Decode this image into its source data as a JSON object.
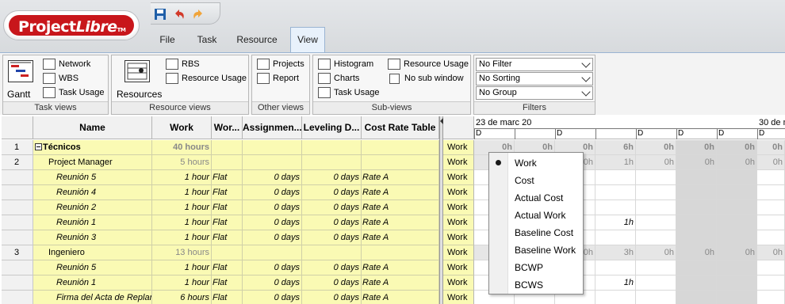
{
  "app": {
    "logo_word1": "Project",
    "logo_word2": "Libre",
    "logo_tm": "TM",
    "brand_color": "#c8161b"
  },
  "quick_access": [
    {
      "name": "save-icon"
    },
    {
      "name": "undo-icon"
    },
    {
      "name": "redo-icon"
    }
  ],
  "menu_tabs": [
    {
      "label": "File"
    },
    {
      "label": "Task"
    },
    {
      "label": "Resource"
    },
    {
      "label": "View",
      "active": true
    }
  ],
  "ribbon": {
    "task_views": {
      "title": "Task views",
      "gantt": "Gantt",
      "network": "Network",
      "wbs": "WBS",
      "task_usage": "Task Usage"
    },
    "resource_views": {
      "title": "Resource views",
      "resources": "Resources",
      "rbs": "RBS",
      "resource_usage": "Resource Usage"
    },
    "other_views": {
      "title": "Other views",
      "projects": "Projects",
      "report": "Report"
    },
    "sub_views": {
      "title": "Sub-views",
      "histogram": "Histogram",
      "charts": "Charts",
      "task_usage": "Task Usage",
      "resource_usage": "Resource Usage",
      "no_sub_window": "No sub window"
    },
    "filters": {
      "title": "Filters",
      "filter": "No Filter",
      "sorting": "No Sorting",
      "group": "No Group"
    }
  },
  "table": {
    "columns": [
      "Name",
      "Work",
      "Wor...",
      "Assignmen...",
      "Leveling D...",
      "Cost Rate Table"
    ],
    "rows": [
      {
        "num": "1",
        "name": "Técnicos",
        "work": "40 hours",
        "contour": "",
        "delay": "",
        "leveling": "",
        "rate": "",
        "type": "resource-bold"
      },
      {
        "num": "2",
        "name": "Project Manager",
        "work": "5 hours",
        "contour": "",
        "delay": "",
        "leveling": "",
        "rate": "",
        "type": "resource"
      },
      {
        "num": "",
        "name": "Reunión 5",
        "work": "1 hour",
        "contour": "Flat",
        "delay": "0 days",
        "leveling": "0 days",
        "rate": "Rate A",
        "type": "assignment"
      },
      {
        "num": "",
        "name": "Reunión 4",
        "work": "1 hour",
        "contour": "Flat",
        "delay": "0 days",
        "leveling": "0 days",
        "rate": "Rate A",
        "type": "assignment"
      },
      {
        "num": "",
        "name": "Reunión 2",
        "work": "1 hour",
        "contour": "Flat",
        "delay": "0 days",
        "leveling": "0 days",
        "rate": "Rate A",
        "type": "assignment"
      },
      {
        "num": "",
        "name": "Reunión 1",
        "work": "1 hour",
        "contour": "Flat",
        "delay": "0 days",
        "leveling": "0 days",
        "rate": "Rate A",
        "type": "assignment"
      },
      {
        "num": "",
        "name": "Reunión 3",
        "work": "1 hour",
        "contour": "Flat",
        "delay": "0 days",
        "leveling": "0 days",
        "rate": "Rate A",
        "type": "assignment"
      },
      {
        "num": "3",
        "name": "Ingeniero",
        "work": "13 hours",
        "contour": "",
        "delay": "",
        "leveling": "",
        "rate": "",
        "type": "resource"
      },
      {
        "num": "",
        "name": "Reunión 5",
        "work": "1 hour",
        "contour": "Flat",
        "delay": "0 days",
        "leveling": "0 days",
        "rate": "Rate A",
        "type": "assignment"
      },
      {
        "num": "",
        "name": "Reunión 1",
        "work": "1 hour",
        "contour": "Flat",
        "delay": "0 days",
        "leveling": "0 days",
        "rate": "Rate A",
        "type": "assignment"
      },
      {
        "num": "",
        "name": "Firma del Acta de Replan",
        "work": "6 hours",
        "contour": "Flat",
        "delay": "0 days",
        "leveling": "0 days",
        "rate": "Rate A",
        "type": "assignment"
      }
    ]
  },
  "usage": {
    "week1": "23 de marc 20",
    "week2": "30 de m",
    "day_letters": [
      "D",
      "",
      "D",
      "",
      "D",
      "D",
      "D",
      "D",
      "D",
      "",
      "D"
    ],
    "row_label": "Work",
    "rows": [
      [
        "",
        "0h",
        "0h",
        "0h",
        "6h",
        "0h",
        "0h",
        "0h",
        "0h"
      ],
      [
        "",
        "",
        "",
        "0h",
        "1h",
        "0h",
        "0h",
        "0h",
        "0h"
      ],
      [
        "",
        "",
        "",
        "",
        "",
        "",
        "",
        "",
        ""
      ],
      [
        "",
        "",
        "",
        "",
        "",
        "",
        "",
        "",
        ""
      ],
      [
        "",
        "",
        "",
        "",
        "",
        "",
        "",
        "",
        ""
      ],
      [
        "",
        "",
        "",
        "",
        "1h",
        "",
        "",
        "",
        ""
      ],
      [
        "",
        "",
        "",
        "",
        "",
        "",
        "",
        "",
        ""
      ],
      [
        "",
        "",
        "",
        "0h",
        "3h",
        "0h",
        "0h",
        "0h",
        "0h"
      ],
      [
        "",
        "",
        "",
        "",
        "",
        "",
        "",
        "",
        ""
      ],
      [
        "",
        "",
        "",
        "",
        "1h",
        "",
        "",
        "",
        ""
      ],
      [
        "",
        "",
        "",
        "",
        "",
        "",
        "",
        "",
        ""
      ]
    ]
  },
  "popup": {
    "items": [
      "Work",
      "Cost",
      "Actual Cost",
      "Actual Work",
      "Baseline Cost",
      "Baseline Work",
      "BCWP",
      "BCWS"
    ],
    "selected": "Work"
  }
}
